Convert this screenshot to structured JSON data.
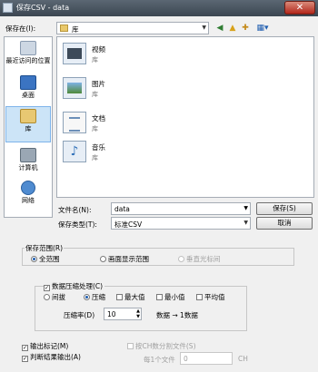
{
  "window": {
    "title": "保存CSV - data",
    "close_label": "✕"
  },
  "toolbar": {
    "save_in_label": "保存在(I):",
    "location_value": "库"
  },
  "places": [
    {
      "label": "最近访问的位置"
    },
    {
      "label": "桌面"
    },
    {
      "label": "库"
    },
    {
      "label": "计算机"
    },
    {
      "label": "网络"
    }
  ],
  "libraries": [
    {
      "name": "视频",
      "sub": "库"
    },
    {
      "name": "图片",
      "sub": "库"
    },
    {
      "name": "文档",
      "sub": "库"
    },
    {
      "name": "音乐",
      "sub": "库"
    }
  ],
  "file": {
    "name_label": "文件名(N):",
    "name_value": "data",
    "type_label": "保存类型(T):",
    "type_value": "标准CSV",
    "save_button": "保存(S)",
    "cancel_button": "取消"
  },
  "range": {
    "title": "保存范围(R)",
    "options": [
      "全范围",
      "画面显示范围",
      "垂直光标间"
    ]
  },
  "compression": {
    "title": "数据压缩处理(C)",
    "mode_options": [
      "间拔",
      "压缩"
    ],
    "checks": [
      "最大值",
      "最小值",
      "平均值"
    ],
    "ratio_label": "压缩率(D)",
    "ratio_value": "10",
    "ratio_note": "数据 → 1数据"
  },
  "bottom": {
    "output_marker": "输出标记(M)",
    "judge_output": "判断结果输出(A)",
    "split_ch": "按CH数分割文件(S)",
    "per_file": "每1个文件",
    "per_file_value": "0",
    "ch_unit": "CH"
  },
  "colors": {
    "accent": "#1f5eb0",
    "titlebar": "#4a5561",
    "close": "#c4392a"
  }
}
